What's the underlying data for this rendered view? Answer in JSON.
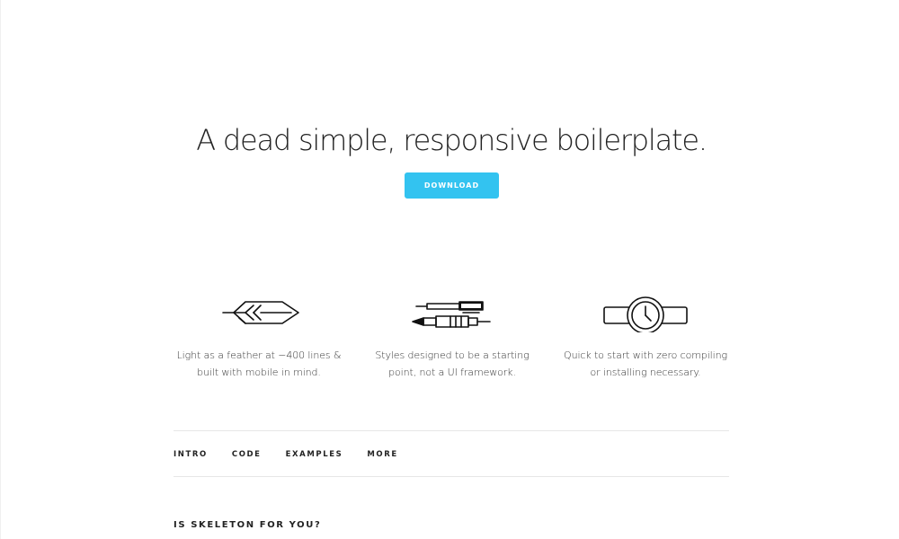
{
  "hero": {
    "title": "A dead simple, responsive boilerplate.",
    "download_label": "DOWNLOAD"
  },
  "features": [
    {
      "icon": "feather-icon",
      "line1": "Light as a feather at ~400 lines &",
      "line2": "built with mobile in mind."
    },
    {
      "icon": "pens-icon",
      "line1": "Styles designed to be a starting",
      "line2": "point, not a UI framework."
    },
    {
      "icon": "watch-icon",
      "line1": "Quick to start with zero compiling",
      "line2": "or installing necessary."
    }
  ],
  "nav": {
    "items": [
      "INTRO",
      "CODE",
      "EXAMPLES",
      "MORE"
    ]
  },
  "section": {
    "title": "IS SKELETON FOR YOU?"
  },
  "colors": {
    "accent": "#33c3f0",
    "text": "#222222",
    "divider": "#e6e6e6"
  }
}
